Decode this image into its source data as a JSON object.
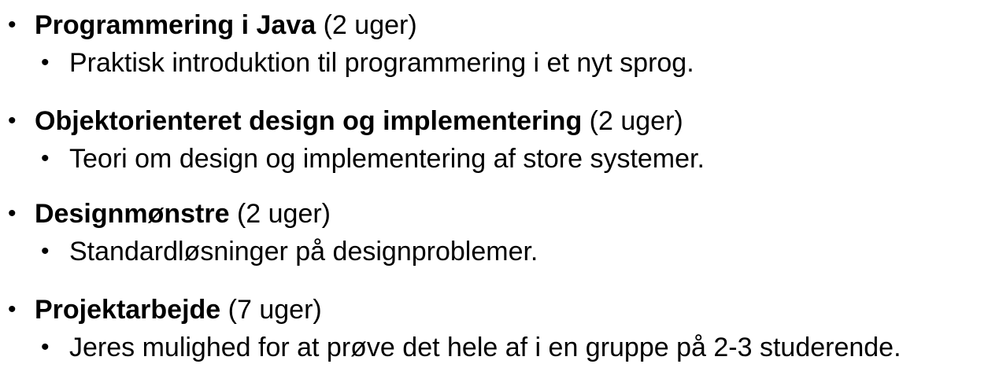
{
  "bullet_glyph": "•",
  "items": [
    {
      "title": "Programmering i Java",
      "duration": " (2 uger)",
      "description": "Praktisk introduktion til programmering i et nyt sprog."
    },
    {
      "title": "Objektorienteret design og implementering",
      "duration": " (2 uger)",
      "description": "Teori om design og implementering af store systemer."
    },
    {
      "title": "Designmønstre",
      "duration": " (2 uger)",
      "description": "Standardløsninger på designproblemer."
    },
    {
      "title": "Projektarbejde",
      "duration": " (7 uger)",
      "description": "Jeres mulighed for at prøve det hele af i en gruppe på 2-3 studerende."
    }
  ]
}
